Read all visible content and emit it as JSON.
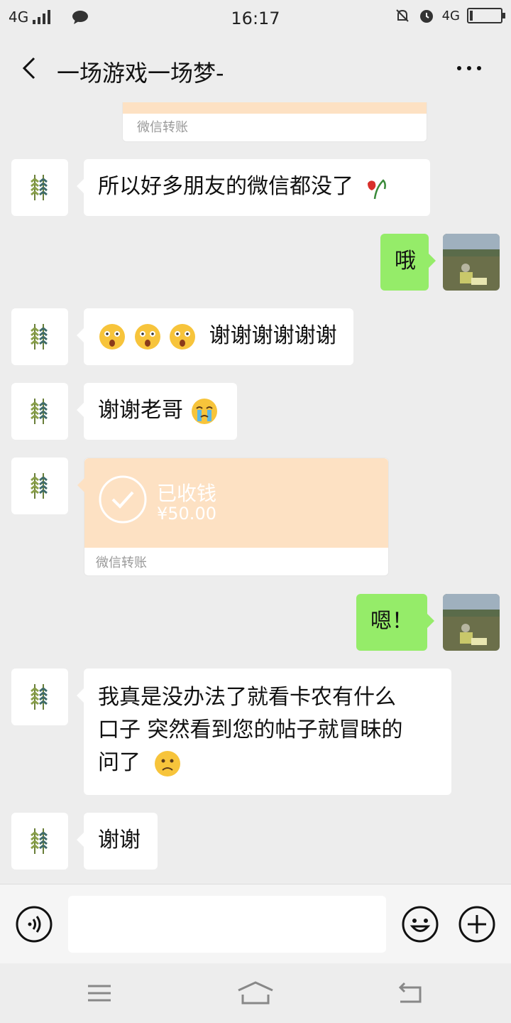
{
  "status_bar": {
    "network_left": "4G",
    "time": "16:17",
    "network_right": "4G"
  },
  "header": {
    "title": "一场游戏一场梦-"
  },
  "messages": [
    {
      "type": "transfer_partial",
      "side": "in",
      "footer": "微信转账"
    },
    {
      "type": "text",
      "side": "in",
      "text": "所以好多朋友的微信都没了",
      "emoji_after": "wilted-rose-emoji"
    },
    {
      "type": "text",
      "side": "out",
      "text": "哦"
    },
    {
      "type": "text",
      "side": "in",
      "emoji_before": [
        "shocked-emoji",
        "shocked-emoji",
        "shocked-emoji"
      ],
      "text": "谢谢谢谢谢谢"
    },
    {
      "type": "text",
      "side": "in",
      "text": "谢谢老哥",
      "emoji_after": "crying-emoji"
    },
    {
      "type": "transfer",
      "side": "in",
      "status": "已收钱",
      "amount": "¥50.00",
      "footer": "微信转账"
    },
    {
      "type": "text",
      "side": "out",
      "text": "嗯！"
    },
    {
      "type": "text",
      "side": "in",
      "lines": [
        "我真是没办法了就看卡农有什么",
        "口子 突然看到您的帖子就冒昧的",
        "问了"
      ],
      "emoji_after": "frown-emoji"
    },
    {
      "type": "text",
      "side": "in",
      "text": "谢谢"
    }
  ],
  "input_bar": {
    "placeholder": ""
  },
  "colors": {
    "background": "#ededed",
    "outgoing_bubble": "#95ec69",
    "incoming_bubble": "#ffffff",
    "transfer_accent": "#fde1c3"
  }
}
